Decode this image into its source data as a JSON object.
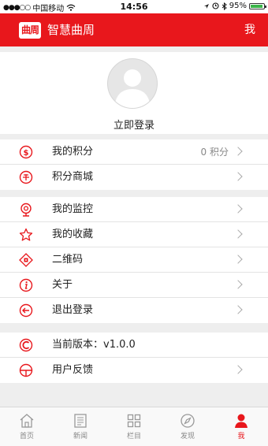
{
  "status_bar": {
    "carrier": "中国移动",
    "time": "14:56",
    "battery": "95%",
    "battery_level": 0.95
  },
  "header": {
    "logo_text": "曲周",
    "title": "智慧曲周",
    "right_label": "我"
  },
  "profile": {
    "login_label": "立即登录"
  },
  "groups": [
    {
      "items": [
        {
          "icon": "dollar-coin-icon",
          "label": "我的积分",
          "value": "0 积分"
        },
        {
          "icon": "points-mall-icon",
          "label": "积分商城",
          "value": ""
        }
      ]
    },
    {
      "items": [
        {
          "icon": "camera-monitor-icon",
          "label": "我的监控",
          "value": ""
        },
        {
          "icon": "star-icon",
          "label": "我的收藏",
          "value": ""
        },
        {
          "icon": "qr-code-icon",
          "label": "二维码",
          "value": ""
        },
        {
          "icon": "info-icon",
          "label": "关于",
          "value": ""
        },
        {
          "icon": "logout-icon",
          "label": "退出登录",
          "value": ""
        }
      ]
    },
    {
      "items": [
        {
          "icon": "version-icon",
          "label": "当前版本：v1.0.0",
          "value": ""
        },
        {
          "icon": "feedback-icon",
          "label": "用户反馈",
          "value": ""
        }
      ]
    }
  ],
  "tabbar": {
    "tabs": [
      {
        "icon": "home-icon",
        "label": "首页"
      },
      {
        "icon": "news-icon",
        "label": "新闻"
      },
      {
        "icon": "columns-icon",
        "label": "栏目"
      },
      {
        "icon": "compass-icon",
        "label": "发现"
      },
      {
        "icon": "user-icon",
        "label": "我"
      }
    ],
    "active_index": 4
  },
  "colors": {
    "brand_red": "#e8171c",
    "background": "#eeeeee",
    "inactive_tab": "#888888"
  }
}
